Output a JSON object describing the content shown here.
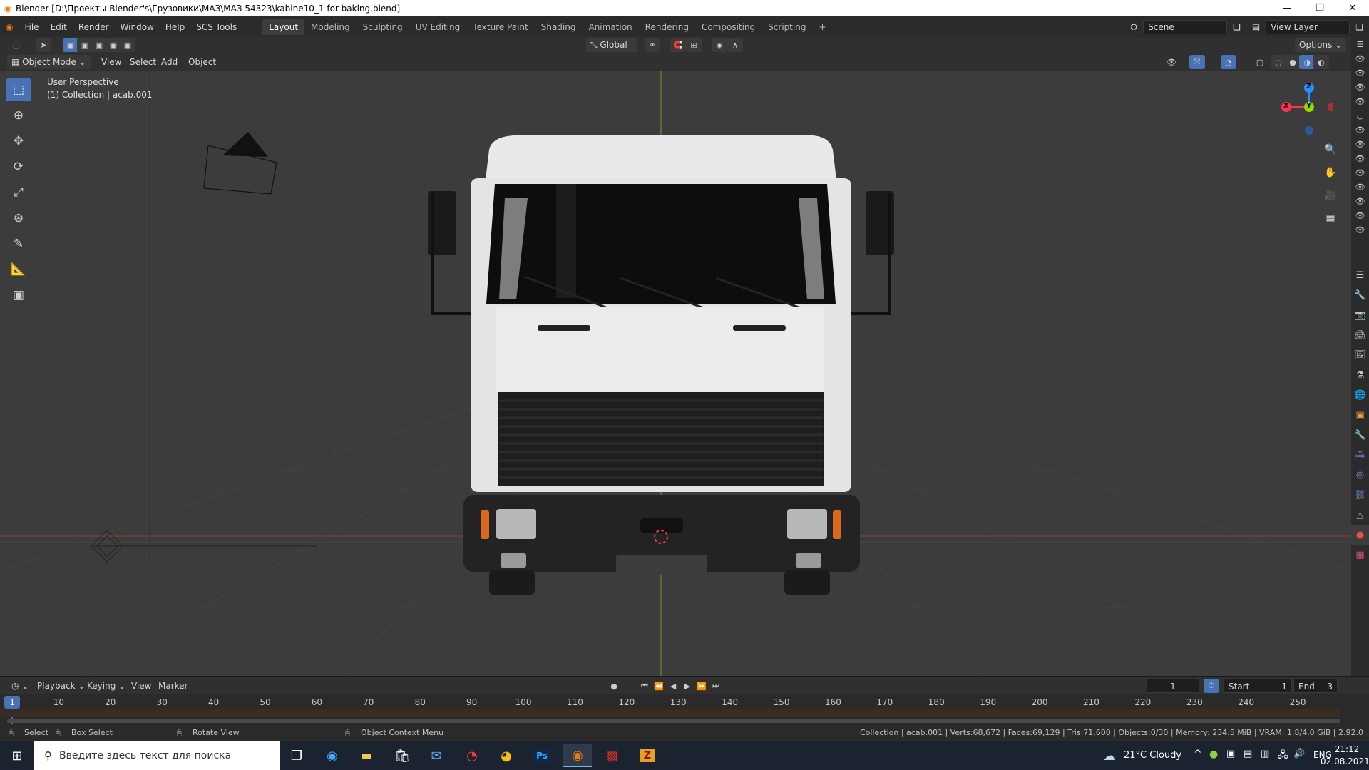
{
  "window": {
    "title": "Blender [D:\\Проекты Blender's\\Грузовики\\МАЗ\\МАЗ 54323\\kabine10_1 for baking.blend]"
  },
  "menu": [
    "File",
    "Edit",
    "Render",
    "Window",
    "Help",
    "SCS Tools"
  ],
  "workspaces": [
    "Layout",
    "Modeling",
    "Sculpting",
    "UV Editing",
    "Texture Paint",
    "Shading",
    "Animation",
    "Rendering",
    "Compositing",
    "Scripting"
  ],
  "active_workspace": "Layout",
  "scene": {
    "name": "Scene",
    "view_layer": "View Layer"
  },
  "toolbar": {
    "orientation": "Global",
    "options_label": "Options"
  },
  "viewport_header": {
    "mode": "Object Mode",
    "menus": [
      "View",
      "Select",
      "Add",
      "Object"
    ]
  },
  "viewport": {
    "perspective": "User Perspective",
    "collection": "(1) Collection | acab.001",
    "gizmo": {
      "x": "X",
      "y": "Y",
      "z": "Z"
    }
  },
  "timeline": {
    "menus": [
      "Playback",
      "Keying",
      "View",
      "Marker"
    ],
    "current_frame": "1",
    "start_label": "Start",
    "start": "1",
    "end_label": "End",
    "end": "3",
    "ruler": [
      "10",
      "20",
      "30",
      "40",
      "50",
      "60",
      "70",
      "80",
      "90",
      "100",
      "110",
      "120",
      "130",
      "140",
      "150",
      "160",
      "170",
      "180",
      "190",
      "200",
      "210",
      "220",
      "230",
      "240",
      "250"
    ],
    "ruler_frame_values": [
      10,
      20,
      30,
      40,
      50,
      60,
      70,
      80,
      90,
      100,
      110,
      120,
      130,
      140,
      150,
      160,
      170,
      180,
      190,
      200,
      210,
      220,
      230,
      240,
      250
    ],
    "visible_range": [
      0,
      258
    ]
  },
  "status": {
    "select": "Select",
    "box_select": "Box Select",
    "rotate_view": "Rotate View",
    "context_menu": "Object Context Menu",
    "stats": "Collection | acab.001 | Verts:68,672 | Faces:69,129 | Tris:71,600 | Objects:0/30 | Memory: 234.5 MiB | VRAM: 1.8/4.0 GiB | 2.92.0"
  },
  "taskbar": {
    "search_placeholder": "Введите здесь текст для поиска",
    "weather": "21°C  Cloudy",
    "lang": "ENG",
    "time": "21:12",
    "date": "02.08.2021"
  },
  "colors": {
    "accent": "#4772b3",
    "active_tool": "#4772b3",
    "x_axis": "#ff3352",
    "y_axis": "#8bdc00",
    "z_axis": "#2890ff",
    "timeline_marker": "#4772b3"
  }
}
